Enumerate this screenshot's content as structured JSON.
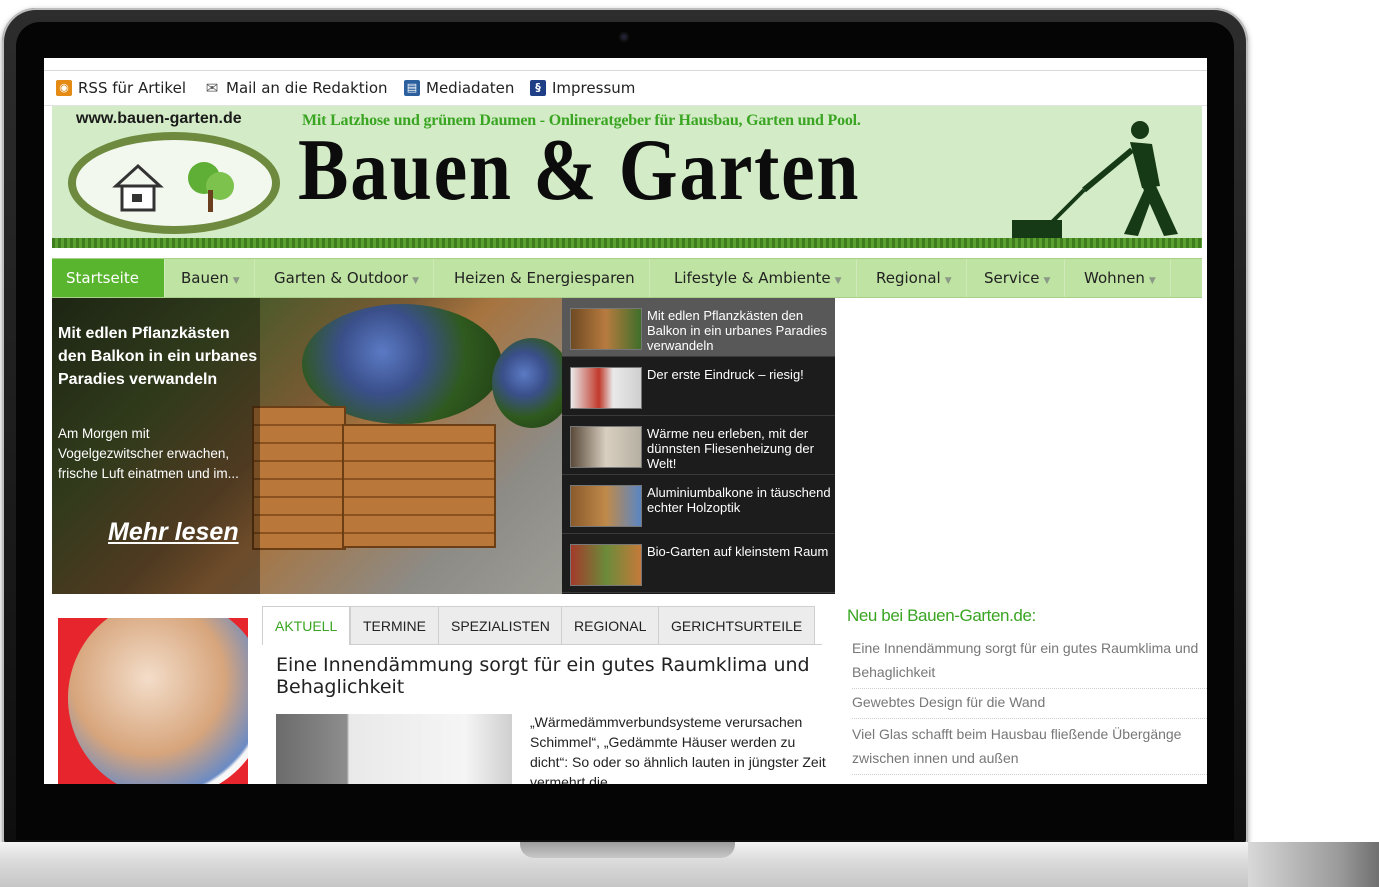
{
  "topbar": {
    "items": [
      {
        "label": "RSS für Artikel",
        "icon": "rss-icon"
      },
      {
        "label": "Mail an die Redaktion",
        "icon": "mail-icon"
      },
      {
        "label": "Mediadaten",
        "icon": "chart-icon"
      },
      {
        "label": "Impressum",
        "icon": "paragraph-icon"
      }
    ]
  },
  "banner": {
    "url": "www.bauen-garten.de",
    "slogan": "Mit Latzhose und grünem Daumen - Onlineratgeber für Hausbau, Garten und Pool.",
    "title": "Bauen & Garten"
  },
  "nav": {
    "items": [
      "Startseite",
      "Bauen",
      "Garten & Outdoor",
      "Heizen & Energiesparen",
      "Lifestyle & Ambiente",
      "Regional",
      "Service",
      "Wohnen"
    ]
  },
  "slider": {
    "title": "Mit edlen Pflanzkästen den Balkon in ein urbanes Paradies verwandeln",
    "text": "Am Morgen mit Vogelgezwitscher erwachen, frische Luft einatmen und im...",
    "more": "Mehr lesen",
    "thumbs": [
      "Mit edlen Pflanzkästen den Balkon in ein urbanes Paradies verwandeln",
      "Der erste Eindruck – riesig!",
      "Wärme neu erleben, mit der dünnsten Fliesenheizung der Welt!",
      "Aluminiumbalkone in täuschend echter Holzoptik",
      "Bio-Garten auf kleinstem Raum"
    ]
  },
  "tabs": [
    "AKTUELL",
    "TERMINE",
    "SPEZIALISTEN",
    "REGIONAL",
    "GERICHTSURTEILE"
  ],
  "article": {
    "title": "Eine Innendämmung sorgt für ein gutes Raumklima und Behaglichkeit",
    "text": "„Wärmedämmverbundsysteme verursachen Schimmel“, „Gedämmte Häuser werden zu dicht“: So oder so ähnlich lauten in jüngster Zeit vermehrt die"
  },
  "sidebar": {
    "heading": "Neu bei Bauen-Garten.de:",
    "links": [
      "Eine Innendämmung sorgt für ein gutes Raumklima und Behaglichkeit",
      "Gewebtes Design für die Wand",
      "Viel Glas schafft beim Hausbau fließende Übergänge zwischen innen und außen"
    ]
  },
  "colors": {
    "accent_green": "#58b52d",
    "nav_bg": "#bfe3a2",
    "banner_bg": "#d3ecc7",
    "link_green": "#3aa522"
  }
}
